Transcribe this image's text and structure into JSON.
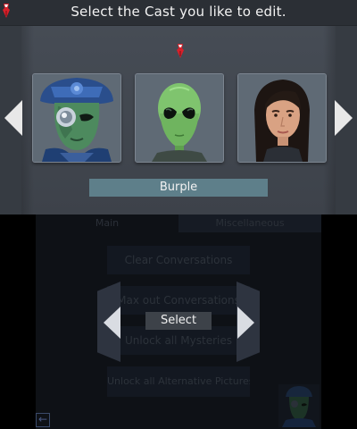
{
  "top_screen": {
    "title": "Select the Cast you like to edit.",
    "selected_name": "Burple",
    "portraits": [
      {
        "icon": "alien-officer-portrait"
      },
      {
        "icon": "green-alien-portrait"
      },
      {
        "icon": "woman-portrait"
      }
    ],
    "nav_left_icon": "arrow-left-icon",
    "nav_right_icon": "arrow-right-icon",
    "selector_icon": "red-pin-icon"
  },
  "bottom_screen": {
    "tabs": [
      {
        "label": "Main"
      },
      {
        "label": "Miscellaneous"
      }
    ],
    "menu": {
      "clear_label": "Clear Conversations",
      "maxout_label": "Max out Conversations",
      "mysteries_label": "Unlock all Mysteries",
      "altpics_label": "Unlock all Alternative Pictures"
    },
    "select_label": "Select",
    "back_icon": "back-arrow-icon"
  },
  "colors": {
    "accent": "#5e7f8a",
    "pin_red": "#d8202a",
    "panel": "#434952",
    "background": "#000000"
  }
}
